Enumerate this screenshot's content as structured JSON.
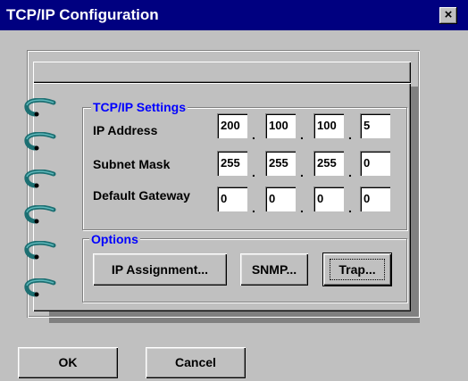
{
  "window": {
    "title": "TCP/IP Configuration",
    "close_glyph": "×"
  },
  "tcpip": {
    "group_label": "TCP/IP Settings",
    "ip_label": "IP Address",
    "ip": [
      "200",
      "100",
      "100",
      "5"
    ],
    "mask_label": "Subnet Mask",
    "mask": [
      "255",
      "255",
      "255",
      "0"
    ],
    "gw_label": "Default Gateway",
    "gw": [
      "0",
      "0",
      "0",
      "0"
    ],
    "separator": "."
  },
  "options": {
    "group_label": "Options",
    "ip_assignment": "IP Assignment...",
    "snmp": "SNMP...",
    "trap": "Trap..."
  },
  "footer": {
    "ok": "OK",
    "cancel": "Cancel"
  },
  "colors": {
    "titlebar": "#000080",
    "face": "#c0c0c0",
    "group_label": "#0000ff",
    "ring": "#2a8a8a"
  },
  "icons": {
    "close": "close-icon",
    "rings": "binder-ring-icon"
  }
}
